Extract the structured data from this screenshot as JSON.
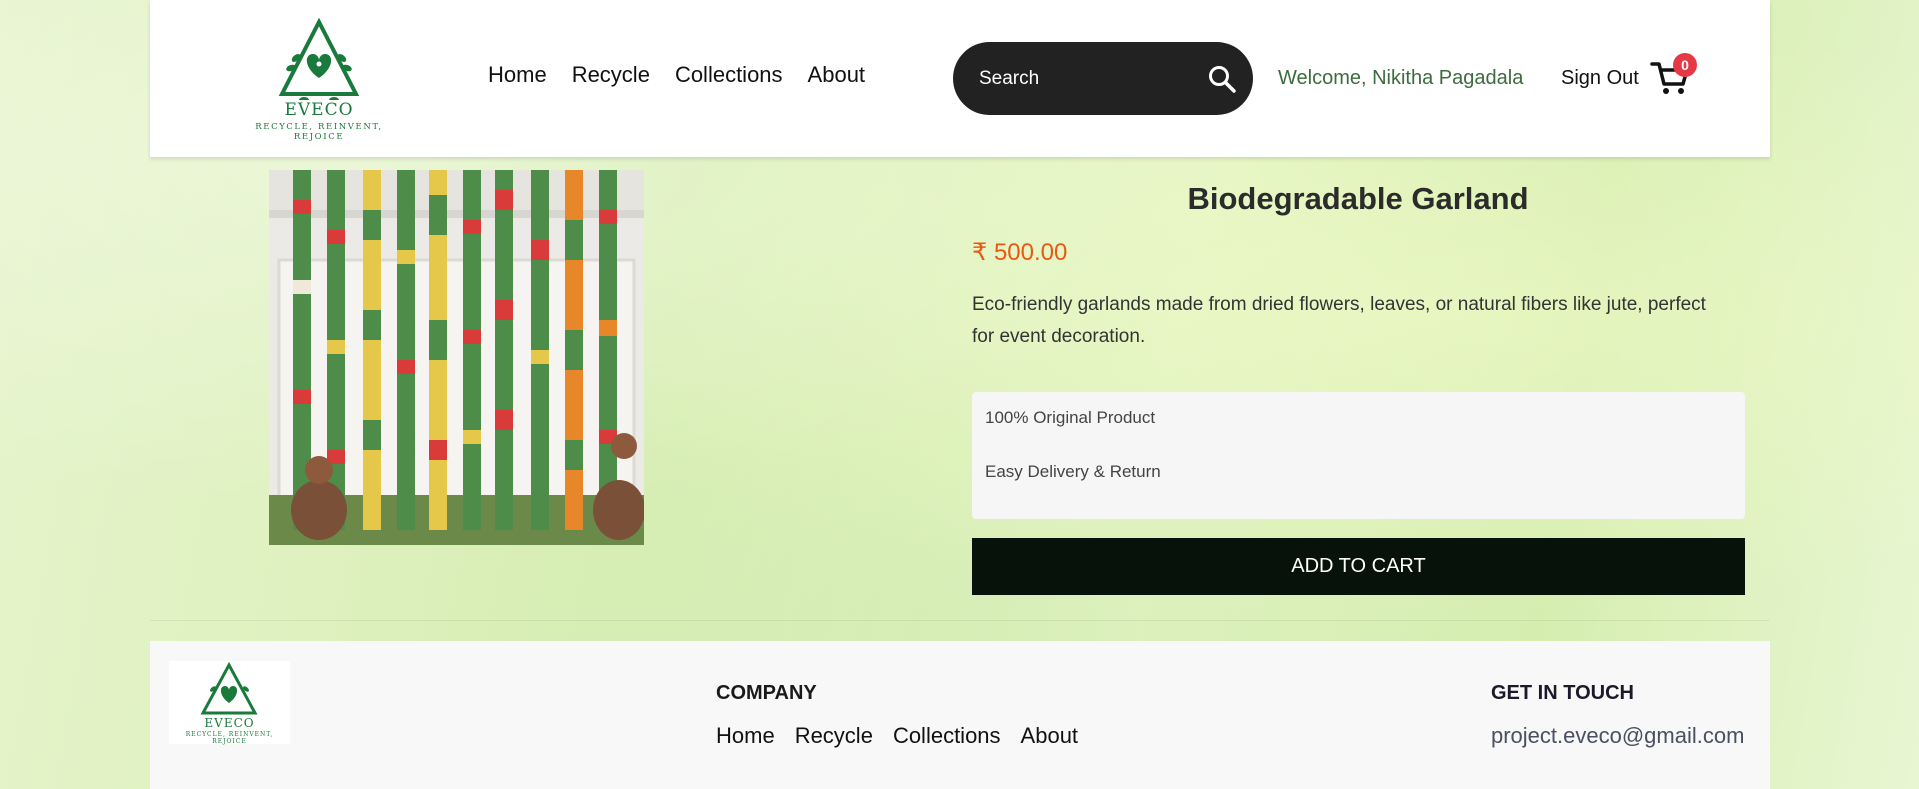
{
  "header": {
    "logo_name": "EVECO",
    "logo_tagline": "RECYCLE, REINVENT, REJOICE",
    "nav": [
      "Home",
      "Recycle",
      "Collections",
      "About"
    ],
    "search_placeholder": "Search",
    "welcome": "Welcome, Nikitha Pagadala",
    "signout": "Sign Out",
    "cart_count": "0"
  },
  "product": {
    "title": "Biodegradable Garland",
    "price": "₹ 500.00",
    "description": "Eco-friendly garlands made from dried flowers, leaves, or natural fibers like jute, perfect for event decoration.",
    "features": [
      "100% Original Product",
      "Easy Delivery & Return"
    ],
    "add_to_cart": "ADD TO CART"
  },
  "footer": {
    "logo_name": "EVECO",
    "logo_tagline": "RECYCLE, REINVENT, REJOICE",
    "company_heading": "COMPANY",
    "links": [
      "Home",
      "Recycle",
      "Collections",
      "About"
    ],
    "contact_heading": "GET IN TOUCH",
    "email": "project.eveco@gmail.com"
  },
  "colors": {
    "brand_green": "#1a7a3c",
    "price": "#e85a12",
    "badge": "#e63946",
    "button": "#07120a"
  },
  "icons": [
    "recycle-heart-logo",
    "search-icon",
    "cart-icon"
  ]
}
